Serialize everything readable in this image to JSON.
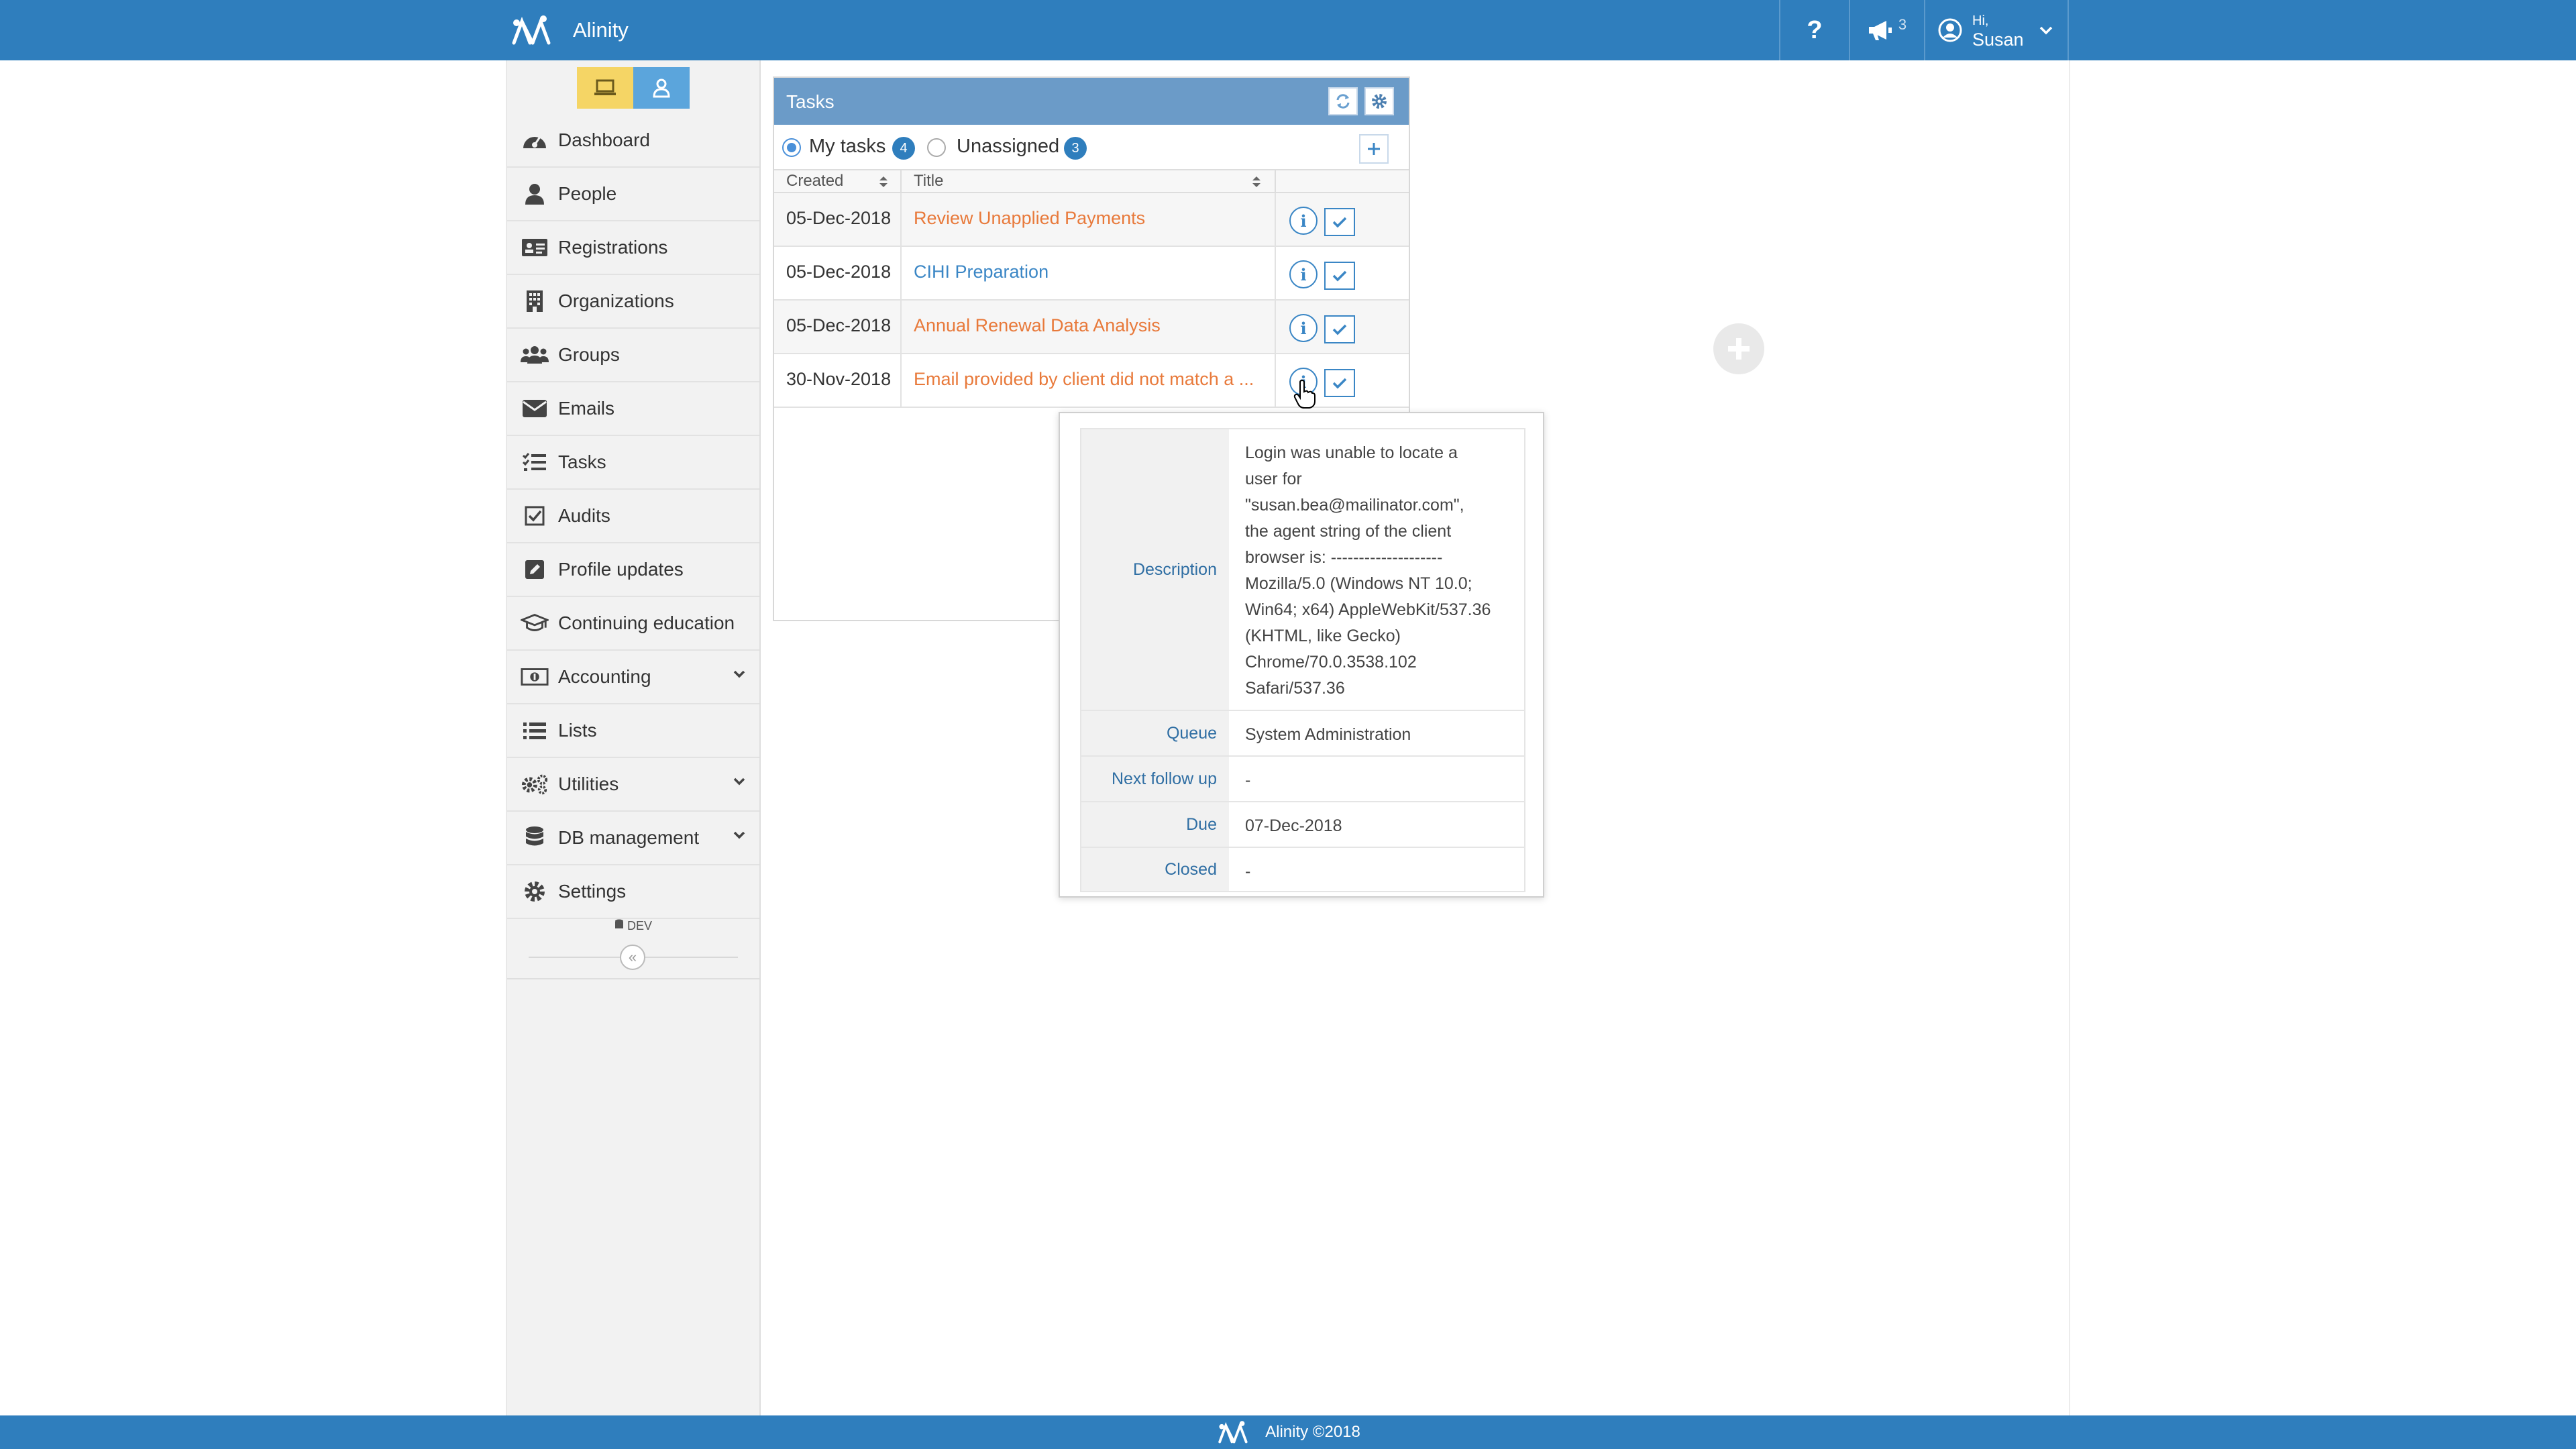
{
  "app": {
    "name": "Alinity",
    "help_label": "?",
    "announcements_count": "3",
    "user_greeting": "Hi,",
    "user_name": "Susan"
  },
  "sidebar": {
    "items": [
      {
        "label": "Dashboard",
        "icon": "dashboard-icon"
      },
      {
        "label": "People",
        "icon": "person-icon"
      },
      {
        "label": "Registrations",
        "icon": "id-card-icon"
      },
      {
        "label": "Organizations",
        "icon": "building-icon"
      },
      {
        "label": "Groups",
        "icon": "users-icon"
      },
      {
        "label": "Emails",
        "icon": "envelope-icon"
      },
      {
        "label": "Tasks",
        "icon": "tasks-icon"
      },
      {
        "label": "Audits",
        "icon": "checkbox-icon"
      },
      {
        "label": "Profile updates",
        "icon": "edit-icon"
      },
      {
        "label": "Continuing education",
        "icon": "graduation-cap-icon"
      },
      {
        "label": "Accounting",
        "icon": "money-icon",
        "has_dropdown": true
      },
      {
        "label": "Lists",
        "icon": "list-icon"
      },
      {
        "label": "Utilities",
        "icon": "cogs-icon",
        "has_dropdown": true
      },
      {
        "label": "DB management",
        "icon": "database-icon",
        "has_dropdown": true
      },
      {
        "label": "Settings",
        "icon": "gear-icon"
      }
    ],
    "env_label": "DEV",
    "collapse_glyph": "«"
  },
  "tasks": {
    "title": "Tasks",
    "filters": {
      "my_tasks_label": "My tasks",
      "my_tasks_count": "4",
      "unassigned_label": "Unassigned",
      "unassigned_count": "3",
      "selected": "My tasks"
    },
    "columns": [
      "Created",
      "Title"
    ],
    "rows": [
      {
        "created": "05-Dec-2018",
        "title": "Review Unapplied Payments",
        "color": "#e8793a"
      },
      {
        "created": "05-Dec-2018",
        "title": "CIHI Preparation",
        "color": "#3a86c5"
      },
      {
        "created": "05-Dec-2018",
        "title": "Annual Renewal Data Analysis",
        "color": "#e8793a"
      },
      {
        "created": "30-Nov-2018",
        "title": "Email provided by client did not match a ...",
        "color": "#e8793a"
      }
    ]
  },
  "popover": {
    "description_label": "Description",
    "description_lines": [
      "Login was unable to locate a",
      "user for",
      "\"susan.bea@mailinator.com\",",
      "the agent string of the client",
      "browser is: --------------------",
      "Mozilla/5.0 (Windows NT 10.0;",
      "Win64; x64) AppleWebKit/537.36",
      "(KHTML, like Gecko)",
      "Chrome/70.0.3538.102",
      "Safari/537.36"
    ],
    "queue_label": "Queue",
    "queue_value": "System Administration",
    "next_follow_up_label": "Next follow up",
    "next_follow_up_value": "-",
    "due_label": "Due",
    "due_value": "07-Dec-2018",
    "closed_label": "Closed",
    "closed_value": "-"
  },
  "footer": {
    "text": "Alinity ©2018"
  },
  "colors": {
    "brand_blue": "#2f7ebd",
    "panel_header": "#6b9bc8",
    "link_orange": "#e8793a",
    "link_blue": "#3a86c5",
    "mode_yellow": "#f5d565",
    "mode_blue": "#5ba5dc"
  }
}
